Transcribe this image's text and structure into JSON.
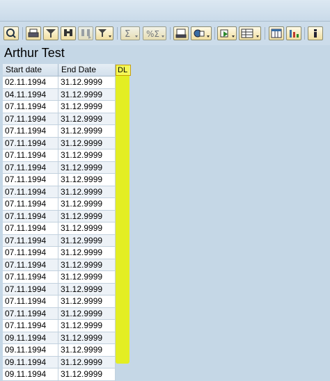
{
  "list": {
    "title": "Arthur Test"
  },
  "columns": {
    "start_date": "Start date",
    "end_date": "End Date",
    "dl": "DL"
  },
  "rows": [
    {
      "start": "02.11.1994",
      "end": "31.12.9999"
    },
    {
      "start": "04.11.1994",
      "end": "31.12.9999"
    },
    {
      "start": "07.11.1994",
      "end": "31.12.9999"
    },
    {
      "start": "07.11.1994",
      "end": "31.12.9999"
    },
    {
      "start": "07.11.1994",
      "end": "31.12.9999"
    },
    {
      "start": "07.11.1994",
      "end": "31.12.9999"
    },
    {
      "start": "07.11.1994",
      "end": "31.12.9999"
    },
    {
      "start": "07.11.1994",
      "end": "31.12.9999"
    },
    {
      "start": "07.11.1994",
      "end": "31.12.9999"
    },
    {
      "start": "07.11.1994",
      "end": "31.12.9999"
    },
    {
      "start": "07.11.1994",
      "end": "31.12.9999"
    },
    {
      "start": "07.11.1994",
      "end": "31.12.9999"
    },
    {
      "start": "07.11.1994",
      "end": "31.12.9999"
    },
    {
      "start": "07.11.1994",
      "end": "31.12.9999"
    },
    {
      "start": "07.11.1994",
      "end": "31.12.9999"
    },
    {
      "start": "07.11.1994",
      "end": "31.12.9999"
    },
    {
      "start": "07.11.1994",
      "end": "31.12.9999"
    },
    {
      "start": "07.11.1994",
      "end": "31.12.9999"
    },
    {
      "start": "07.11.1994",
      "end": "31.12.9999"
    },
    {
      "start": "07.11.1994",
      "end": "31.12.9999"
    },
    {
      "start": "07.11.1994",
      "end": "31.12.9999"
    },
    {
      "start": "09.11.1994",
      "end": "31.12.9999"
    },
    {
      "start": "09.11.1994",
      "end": "31.12.9999"
    },
    {
      "start": "09.11.1994",
      "end": "31.12.9999"
    },
    {
      "start": "09.11.1994",
      "end": "31.12.9999"
    }
  ],
  "highlight_color": "#e8f200",
  "toolbar_icons": [
    "details-icon",
    "print-icon",
    "filter-icon",
    "find-icon",
    "find-next-icon",
    "set-filter-icon",
    "sum-icon",
    "subtotal-icon",
    "print-preview-icon",
    "export-icon",
    "send-icon",
    "spreadsheet-icon",
    "change-layout-icon",
    "abc-analysis-icon",
    "info-icon"
  ]
}
